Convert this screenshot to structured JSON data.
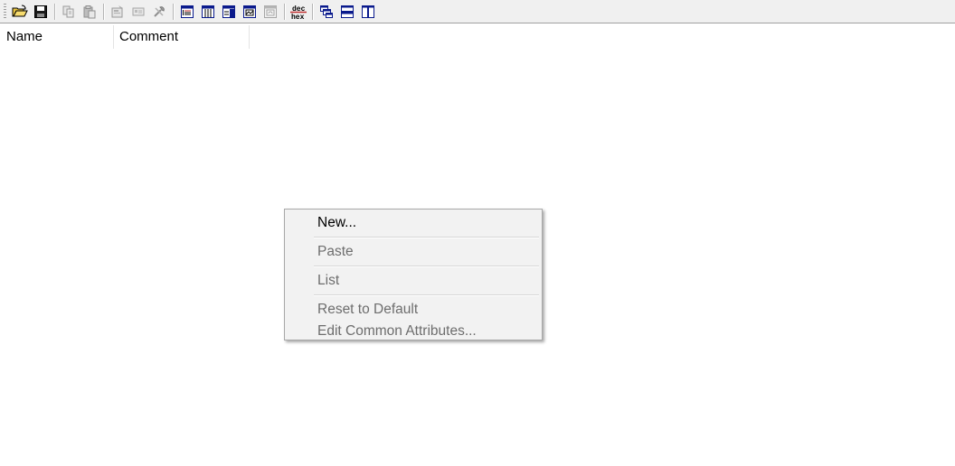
{
  "toolbar": {
    "buttons": [
      {
        "icon": "open-folder-icon"
      },
      {
        "icon": "save-icon"
      },
      {
        "icon": "copy-icon"
      },
      {
        "icon": "paste-icon"
      },
      {
        "icon": "properties-icon"
      },
      {
        "icon": "card-icon"
      },
      {
        "icon": "tools-icon"
      },
      {
        "icon": "details-view-icon"
      },
      {
        "icon": "columns-view-icon"
      },
      {
        "icon": "split-view-icon"
      },
      {
        "icon": "image-view-icon"
      },
      {
        "icon": "disabled-view-icon"
      },
      {
        "icon": "dec-hex-icon"
      },
      {
        "icon": "cascade-windows-icon"
      },
      {
        "icon": "tile-horizontal-icon"
      },
      {
        "icon": "tile-vertical-icon"
      }
    ],
    "dec_label": "dec",
    "hex_label": "hex"
  },
  "list": {
    "columns": [
      {
        "label": "Name"
      },
      {
        "label": "Comment"
      }
    ]
  },
  "context_menu": {
    "items": [
      {
        "label": "New...",
        "enabled": true
      },
      {
        "label": "Paste",
        "enabled": false
      },
      {
        "label": "List",
        "enabled": false
      },
      {
        "label": "Reset to Default",
        "enabled": false
      },
      {
        "label": "Edit Common Attributes...",
        "enabled": false
      }
    ]
  },
  "colors": {
    "toolbar_bg": "#f0f0f0",
    "menu_bg": "#f2f2f2",
    "disabled_text": "#6d6d6d",
    "icon_blue": "#0a1a8c"
  }
}
